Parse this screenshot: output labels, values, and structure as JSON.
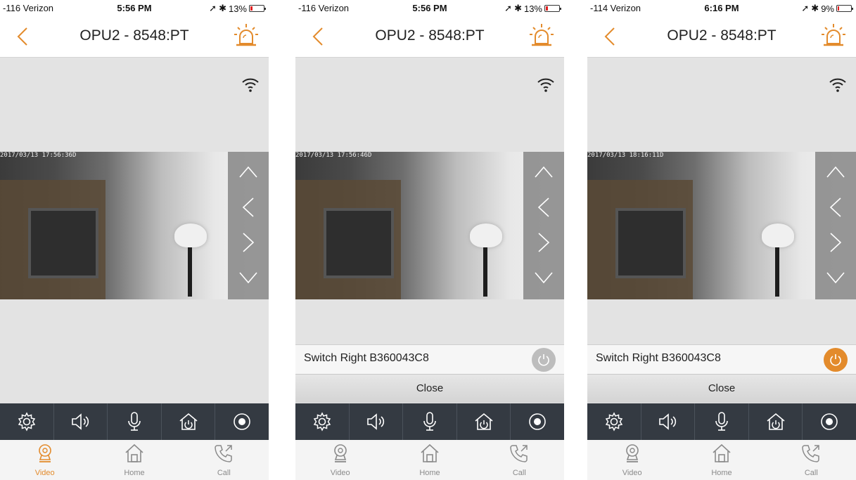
{
  "colors": {
    "accent": "#e38b2c",
    "toolbar_bg": "#343a42",
    "power_off": "#bdbdbd",
    "power_on": "#e38b2c"
  },
  "screens": [
    {
      "status": {
        "carrier": "-116 Verizon",
        "time": "5:56 PM",
        "battery": "13%",
        "battery_level": 0.13
      },
      "title": "OPU2 - 8548:PT",
      "video_timestamp": "2017/03/13 17:56:36D",
      "switch": null,
      "tabs": [
        {
          "label": "Video",
          "active": true
        },
        {
          "label": "Home",
          "active": false
        },
        {
          "label": "Call",
          "active": false
        }
      ]
    },
    {
      "status": {
        "carrier": "-116 Verizon",
        "time": "5:56 PM",
        "battery": "13%",
        "battery_level": 0.13
      },
      "title": "OPU2 - 8548:PT",
      "video_timestamp": "2017/03/13 17:56:46D",
      "switch": {
        "label": "Switch Right B360043C8",
        "state": "off",
        "close_label": "Close"
      },
      "tabs": [
        {
          "label": "Video",
          "active": false
        },
        {
          "label": "Home",
          "active": false
        },
        {
          "label": "Call",
          "active": false
        }
      ]
    },
    {
      "status": {
        "carrier": "-114 Verizon",
        "time": "6:16 PM",
        "battery": "9%",
        "battery_level": 0.09
      },
      "title": "OPU2 - 8548:PT",
      "video_timestamp": "2017/03/13 18:16:11D",
      "switch": {
        "label": "Switch Right B360043C8",
        "state": "on",
        "close_label": "Close"
      },
      "tabs": [
        {
          "label": "Video",
          "active": false
        },
        {
          "label": "Home",
          "active": false
        },
        {
          "label": "Call",
          "active": false
        }
      ]
    }
  ],
  "toolbar_icons": [
    "settings-gear-icon",
    "speaker-icon",
    "microphone-icon",
    "home-power-icon",
    "record-icon"
  ],
  "ptz_icons": [
    "pan-up-icon",
    "pan-left-icon",
    "pan-right-icon",
    "pan-down-icon"
  ]
}
